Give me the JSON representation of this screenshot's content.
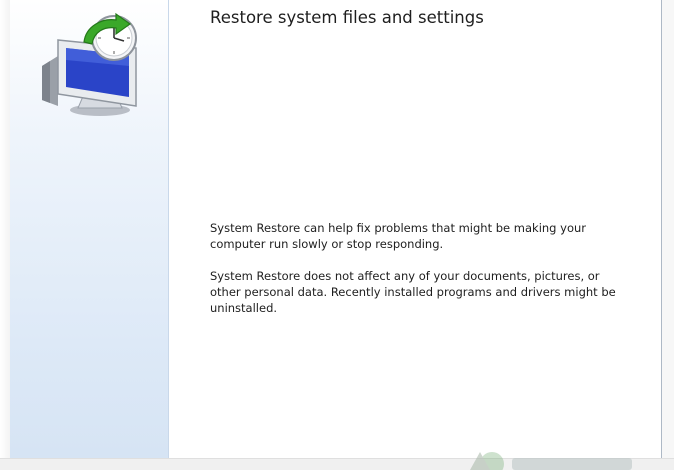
{
  "wizard": {
    "title": "Restore system files and settings",
    "paragraph_1": "System Restore can help fix problems that might be making your computer run slowly or stop responding.",
    "paragraph_2": "System Restore does not affect any of your documents, pictures, or other personal data. Recently installed programs and drivers might be uninstalled."
  },
  "icons": {
    "side": "system-restore-icon",
    "watermark": "watermark-logo"
  },
  "colors": {
    "panel_gradient_bottom": "#d6e4f4",
    "monitor_screen": "#2a44c8",
    "restore_arrow": "#3aa829"
  }
}
